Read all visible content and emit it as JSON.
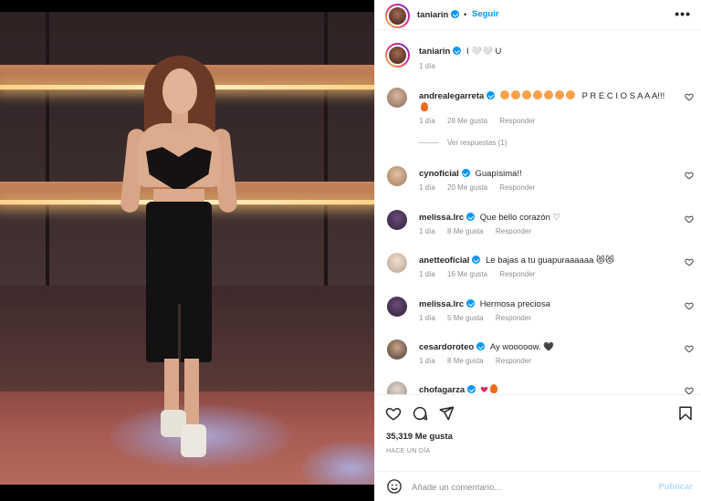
{
  "header": {
    "username": "taniarin",
    "separator": "•",
    "follow_label": "Seguir",
    "more_label": "•••"
  },
  "caption": {
    "username": "taniarin",
    "text": "I 🤍🤍 U",
    "time": "1 día"
  },
  "comments": [
    {
      "username": "andrealegarreta",
      "text": "P R E C I O S A A A!!!",
      "emoji_prefix": [
        "face-with-heart-eyes",
        "face-with-heart-eyes",
        "face-with-heart-eyes",
        "face-with-heart-eyes",
        "face-with-heart-eyes",
        "face-with-heart-eyes",
        "face-with-heart-eyes"
      ],
      "emoji_suffix": "fire",
      "time": "1 día",
      "likes": "28 Me gusta",
      "reply": "Responder",
      "view_replies": "Ver respuestas (1)"
    },
    {
      "username": "cynoficial",
      "text": "Guapísima!!",
      "time": "1 día",
      "likes": "20 Me gusta",
      "reply": "Responder"
    },
    {
      "username": "melissa.lrc",
      "text": "Que bello corazón ♡",
      "time": "1 día",
      "likes": "8 Me gusta",
      "reply": "Responder"
    },
    {
      "username": "anetteoficial",
      "text": "Le bajas a tu guapuraaaaaa 😻😻",
      "time": "1 día",
      "likes": "16 Me gusta",
      "reply": "Responder"
    },
    {
      "username": "melissa.lrc",
      "text": "Hermosa preciosa",
      "time": "1 día",
      "likes": "5 Me gusta",
      "reply": "Responder"
    },
    {
      "username": "cesardoroteo",
      "text": "Ay wooooow. 🖤",
      "time": "1 día",
      "likes": "8 Me gusta",
      "reply": "Responder"
    },
    {
      "username": "chofagarza",
      "text": ""
    }
  ],
  "stats": {
    "likes": "35,319 Me gusta",
    "when": "HACE UN DÍA"
  },
  "add_comment": {
    "placeholder": "Añade un comentario...",
    "publish_label": "Publicar"
  },
  "colors": {
    "accent": "#0095f6",
    "muted": "#8e8e8e",
    "publish_disabled": "#b3dbff"
  },
  "icons": [
    "heart-icon",
    "comment-icon",
    "share-icon",
    "bookmark-icon",
    "smile-icon",
    "verified-icon",
    "more-icon"
  ]
}
